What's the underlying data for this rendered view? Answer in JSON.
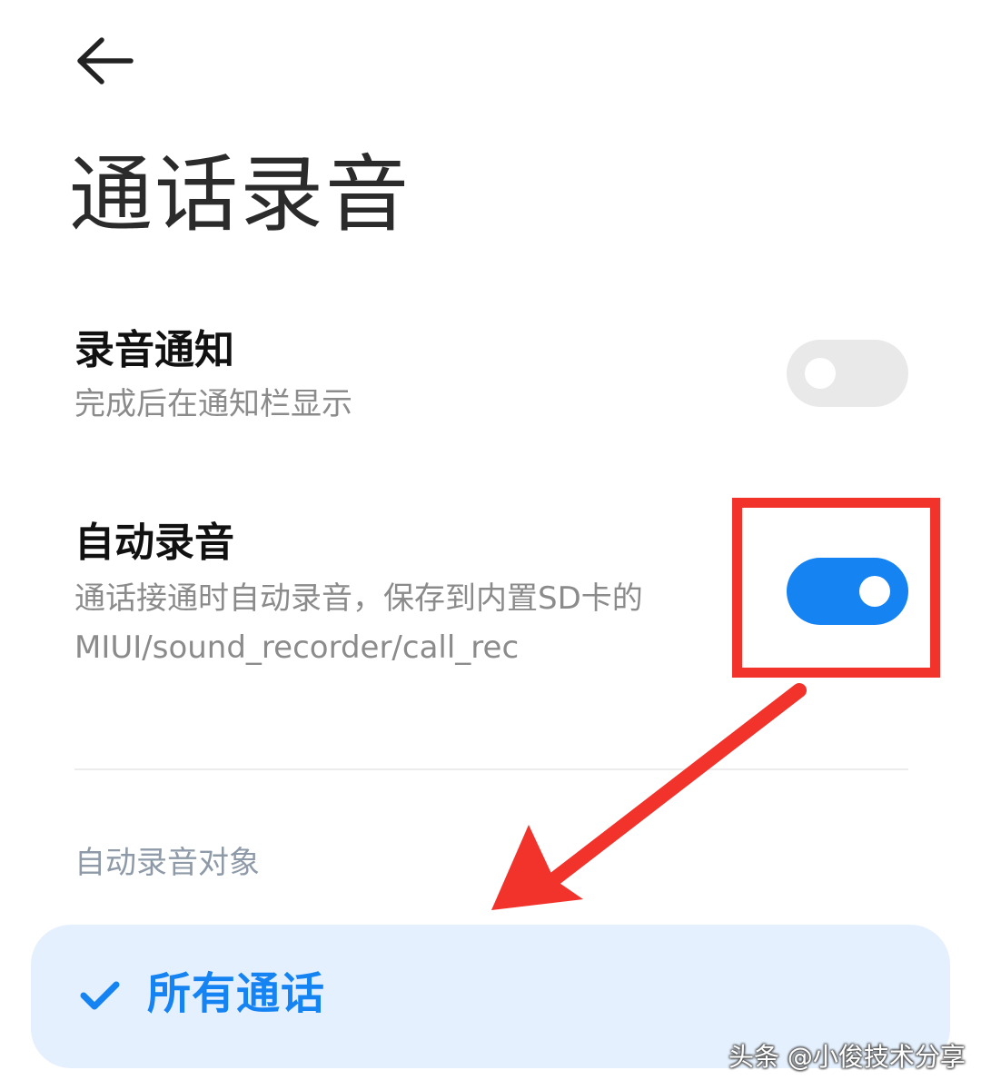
{
  "header": {
    "back_icon": "arrow-left-icon",
    "title": "通话录音"
  },
  "settings": [
    {
      "title": "录音通知",
      "description": "完成后在通知栏显示",
      "toggle_on": false
    },
    {
      "title": "自动录音",
      "description_line1": "通话接通时自动录音，保存到内置SD卡的",
      "description_line2": "MIUI/sound_recorder/call_rec",
      "toggle_on": true
    }
  ],
  "auto_record_targets": {
    "header": "自动录音对象",
    "selected_option": {
      "label": "所有通话",
      "icon": "checkmark-icon",
      "selected": true
    }
  },
  "annotation": {
    "highlight_color": "#f2332b",
    "arrow_color": "#f2332b"
  },
  "watermark": "头条 @小俊技术分享",
  "colors": {
    "accent": "#1683f3",
    "selected_bg": "#e4f0fd",
    "toggle_off": "#e9e9e9"
  }
}
